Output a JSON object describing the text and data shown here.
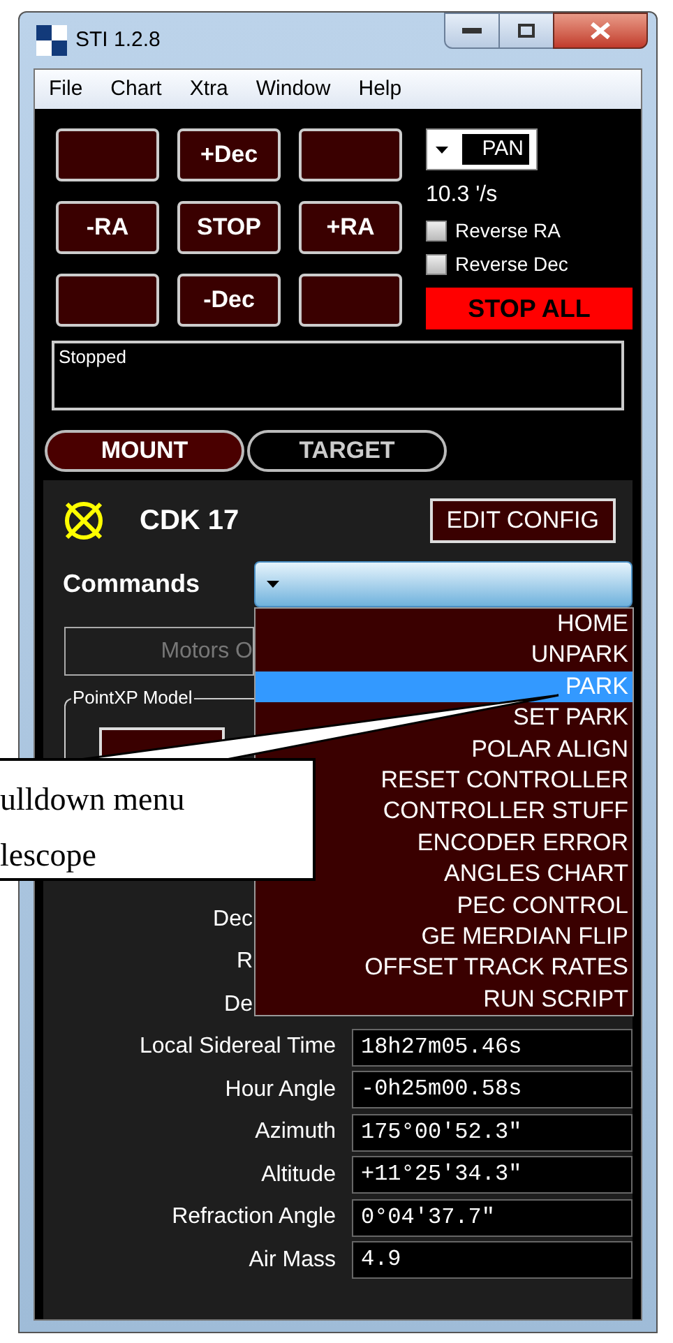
{
  "window": {
    "title": "STI  1.2.8"
  },
  "menu_bar": [
    "File",
    "Chart",
    "Xtra",
    "Window",
    "Help"
  ],
  "jog_buttons": [
    {
      "kind": "blank"
    },
    {
      "kind": "labeled",
      "label": "+Dec"
    },
    {
      "kind": "blank"
    },
    {
      "kind": "labeled",
      "label": "-RA"
    },
    {
      "kind": "labeled",
      "label": "STOP"
    },
    {
      "kind": "labeled",
      "label": "+RA"
    },
    {
      "kind": "blank"
    },
    {
      "kind": "labeled",
      "label": "-Dec"
    },
    {
      "kind": "blank"
    }
  ],
  "rate_dropdown": {
    "value": "PAN"
  },
  "rate_reading": "10.3 '/s",
  "checkboxes": [
    {
      "label": "Reverse RA",
      "checked": false
    },
    {
      "label": "Reverse Dec",
      "checked": false
    }
  ],
  "stop_all_button": "STOP ALL",
  "status_log": "Stopped",
  "tabs": [
    {
      "label": "MOUNT",
      "selected": true
    },
    {
      "label": "TARGET",
      "selected": false
    }
  ],
  "mount": {
    "name": "CDK 17",
    "edit_button": "EDIT CONFIG"
  },
  "commands": {
    "label": "Commands",
    "menu_items": [
      {
        "label": "HOME",
        "selected": false
      },
      {
        "label": "UNPARK",
        "selected": false
      },
      {
        "label": "PARK",
        "selected": true
      },
      {
        "label": "SET PARK",
        "selected": false
      },
      {
        "label": "POLAR ALIGN",
        "selected": false
      },
      {
        "label": "RESET CONTROLLER",
        "selected": false
      },
      {
        "label": "CONTROLLER STUFF",
        "selected": false
      },
      {
        "label": "ENCODER ERROR",
        "selected": false
      },
      {
        "label": "ANGLES CHART",
        "selected": false
      },
      {
        "label": "PEC CONTROL",
        "selected": false
      },
      {
        "label": "GE MERDIAN FLIP",
        "selected": false
      },
      {
        "label": "OFFSET TRACK RATES",
        "selected": false
      },
      {
        "label": "RUN SCRIPT",
        "selected": false
      }
    ]
  },
  "motors_button": "Motors O",
  "pointxp_group": {
    "title": "PointXP Model"
  },
  "readouts": [
    {
      "label": "Dec"
    },
    {
      "label": "R"
    },
    {
      "label": "De"
    },
    {
      "label": "Local Sidereal Time",
      "value": "18h27m05.46s"
    },
    {
      "label": "Hour Angle",
      "value": "-0h25m00.58s"
    },
    {
      "label": "Azimuth",
      "value": "175°00'52.3\""
    },
    {
      "label": "Altitude",
      "value": "+11°25'34.3\""
    },
    {
      "label": "Refraction Angle",
      "value": "0°04'37.7\""
    },
    {
      "label": "Air Mass",
      "value": "4.9"
    }
  ],
  "callout": {
    "lines": [
      "ulldown menu",
      "lescope"
    ]
  }
}
